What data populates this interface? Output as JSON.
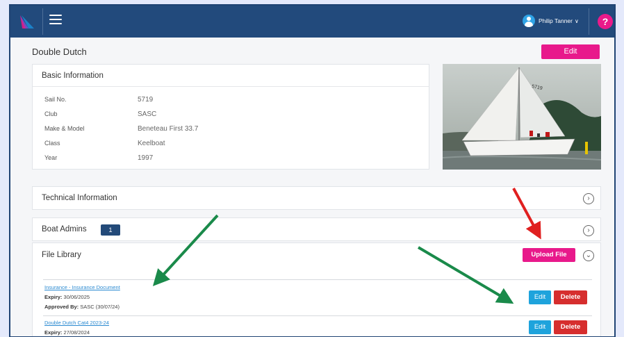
{
  "user": {
    "name": "Philip Tanner",
    "chevron": "∨"
  },
  "help": {
    "label": "?"
  },
  "page": {
    "title": "Double Dutch",
    "edit_label": "Edit"
  },
  "basic_info": {
    "header": "Basic Information",
    "rows": [
      {
        "label": "Sail No.",
        "value": "5719"
      },
      {
        "label": "Club",
        "value": "SASC"
      },
      {
        "label": "Make & Model",
        "value": "Beneteau First 33.7"
      },
      {
        "label": "Class",
        "value": "Keelboat"
      },
      {
        "label": "Year",
        "value": "1997"
      }
    ]
  },
  "photo": {
    "sail_number": "5719"
  },
  "sections": {
    "technical": {
      "title": "Technical Information",
      "icon": "chevron-right-circle-icon"
    },
    "admins": {
      "title": "Boat Admins",
      "count": "1",
      "icon": "chevron-right-circle-icon"
    }
  },
  "file_library": {
    "title": "File Library",
    "upload_label": "Upload File",
    "files": [
      {
        "name": "Insurance - Insurance Document",
        "expiry_label": "Expiry:",
        "expiry": "30/06/2025",
        "approved_label": "Approved By:",
        "approved": "SASC (30/07/24)",
        "edit_label": "Edit",
        "delete_label": "Delete"
      },
      {
        "name": "Double Dutch Cat4 2023-24",
        "expiry_label": "Expiry:",
        "expiry": "27/08/2024",
        "edit_label": "Edit",
        "delete_label": "Delete"
      }
    ]
  },
  "colors": {
    "navbar": "#224a7c",
    "accent_pink": "#e8198b",
    "edit_blue": "#1ea3dc",
    "delete_red": "#d62e2e",
    "annotation_green": "#1a8a4a",
    "annotation_red": "#e02020"
  }
}
